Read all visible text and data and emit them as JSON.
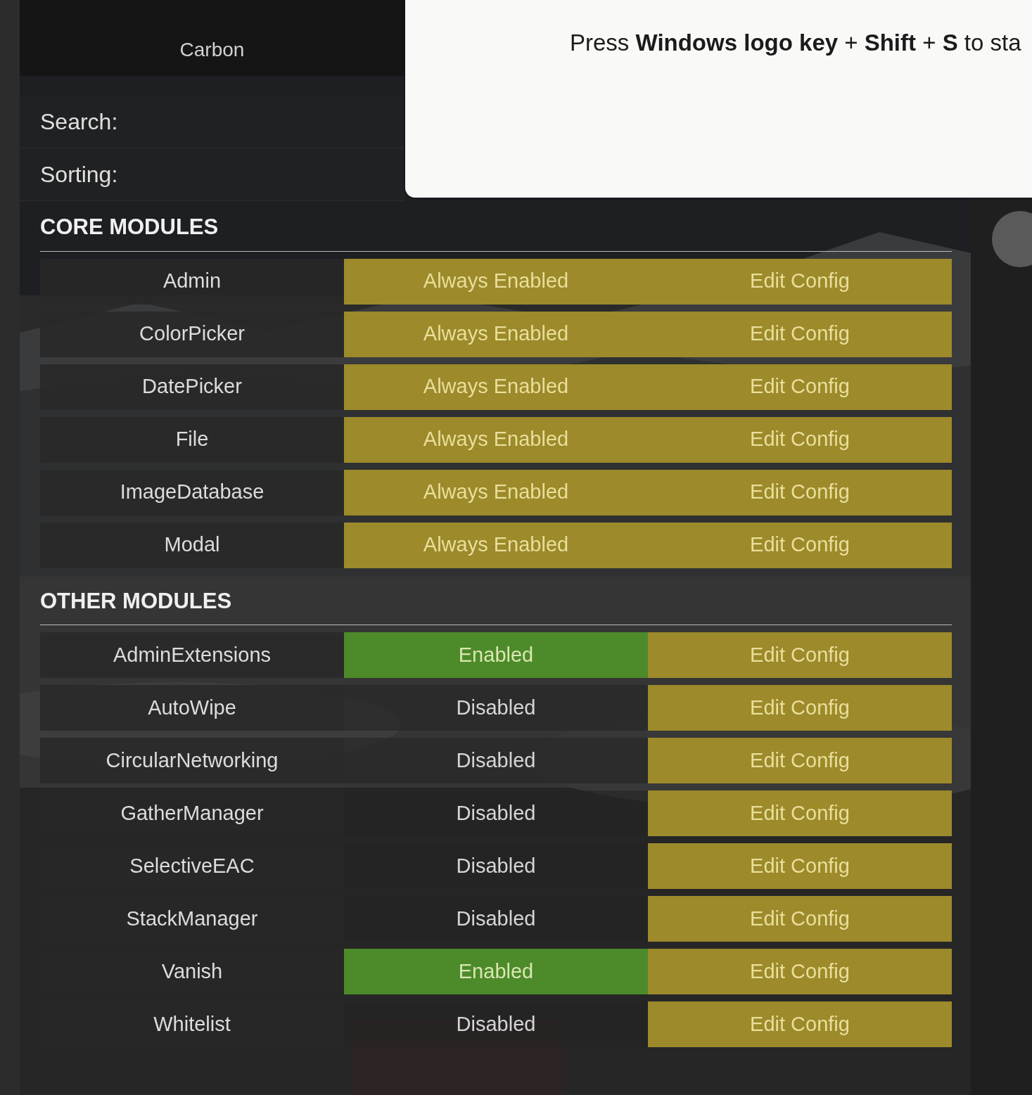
{
  "app": {
    "title": "Carbon"
  },
  "filters": [
    {
      "label": "Search:"
    },
    {
      "label": "Sorting:"
    }
  ],
  "snip_banner": {
    "text": "Press **Windows logo key** + **Shift** + **S** to sta"
  },
  "sections": [
    {
      "title": "CORE MODULES",
      "modules": [
        {
          "name": "Admin",
          "kind": "always",
          "status_label": "Always Enabled",
          "action": "Edit Config"
        },
        {
          "name": "ColorPicker",
          "kind": "always",
          "status_label": "Always Enabled",
          "action": "Edit Config"
        },
        {
          "name": "DatePicker",
          "kind": "always",
          "status_label": "Always Enabled",
          "action": "Edit Config"
        },
        {
          "name": "File",
          "kind": "always",
          "status_label": "Always Enabled",
          "action": "Edit Config"
        },
        {
          "name": "ImageDatabase",
          "kind": "always",
          "status_label": "Always Enabled",
          "action": "Edit Config"
        },
        {
          "name": "Modal",
          "kind": "always",
          "status_label": "Always Enabled",
          "action": "Edit Config"
        }
      ]
    },
    {
      "title": "OTHER MODULES",
      "modules": [
        {
          "name": "AdminExtensions",
          "kind": "enabled",
          "status_label": "Enabled",
          "action": "Edit Config"
        },
        {
          "name": "AutoWipe",
          "kind": "disabled",
          "status_label": "Disabled",
          "action": "Edit Config"
        },
        {
          "name": "CircularNetworking",
          "kind": "disabled",
          "status_label": "Disabled",
          "action": "Edit Config"
        },
        {
          "name": "GatherManager",
          "kind": "disabled",
          "status_label": "Disabled",
          "action": "Edit Config"
        },
        {
          "name": "SelectiveEAC",
          "kind": "disabled",
          "status_label": "Disabled",
          "action": "Edit Config"
        },
        {
          "name": "StackManager",
          "kind": "disabled",
          "status_label": "Disabled",
          "action": "Edit Config"
        },
        {
          "name": "Vanish",
          "kind": "enabled",
          "status_label": "Enabled",
          "action": "Edit Config"
        },
        {
          "name": "Whitelist",
          "kind": "disabled",
          "status_label": "Disabled",
          "action": "Edit Config"
        }
      ]
    }
  ]
}
